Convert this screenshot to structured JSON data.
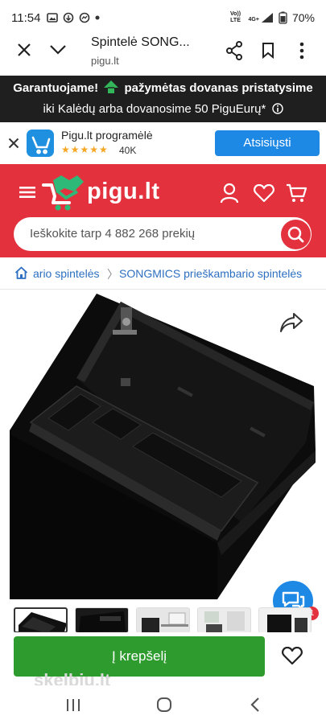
{
  "status_bar": {
    "time": "11:54",
    "network_top": "Vo)) LTE",
    "network_4g": "4G+",
    "battery": "70%"
  },
  "browser": {
    "title": "Spintelė SONG...",
    "url": "pigu.lt"
  },
  "promo": {
    "line1_a": "Garantuojame!",
    "line1_b": "pažymėtas dovanas pristatysime",
    "line2": "iki Kalėdų arba dovanosime 50 PiguEurų*"
  },
  "app_banner": {
    "name": "Pigu.lt programėlė",
    "stars": "★★★★★",
    "count": "40K",
    "download_label": "Atsisiųsti"
  },
  "header": {
    "logo": "pigu.lt",
    "search_placeholder": "Ieškokite tarp 4 882 268 prekių",
    "brand_color": "#e3323e"
  },
  "breadcrumb": {
    "item1": "ario spintelės",
    "separator": "〉",
    "item2": "SONGMICS prieškambario spintelės"
  },
  "cart": {
    "add_label": "Į krepšelį",
    "watermark": "skelbiu.lt"
  },
  "chat": {
    "badge": "1"
  },
  "icons": [
    "close-icon",
    "chevron-down-icon",
    "share-icon",
    "bookmark-icon",
    "menu-icon",
    "user-icon",
    "heart-icon",
    "cart-icon",
    "search-icon",
    "home-icon",
    "info-icon",
    "chat-icon"
  ]
}
